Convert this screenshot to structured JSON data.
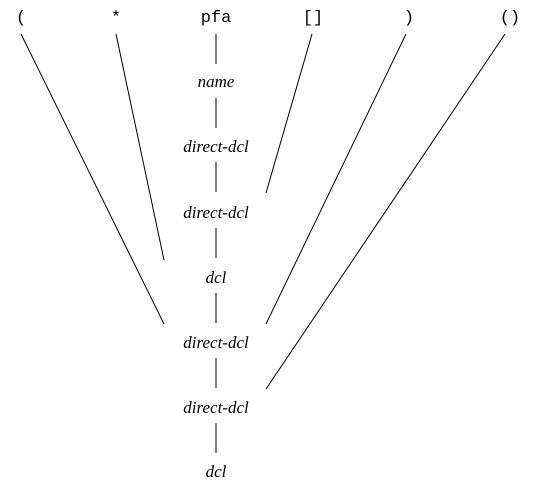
{
  "tokens": [
    "(",
    "*",
    "pfa",
    "[]",
    ")",
    "()"
  ],
  "nodes": [
    "name",
    "direct-dcl",
    "direct-dcl",
    "dcl",
    "direct-dcl",
    "direct-dcl",
    "dcl"
  ]
}
